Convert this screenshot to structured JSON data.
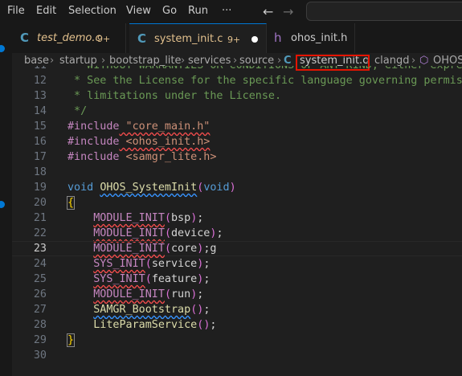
{
  "menubar": {
    "items": [
      "File",
      "Edit",
      "Selection",
      "View",
      "Go",
      "Run",
      "···"
    ],
    "back_arrow": "←",
    "forward_arrow": "→"
  },
  "tabs": [
    {
      "icon": "C",
      "label": "test_demo.c",
      "badge": "9+",
      "italic": true
    },
    {
      "icon": "C",
      "label": "system_init.c",
      "badge": "9+",
      "modified": true
    },
    {
      "icon": "h",
      "label": "ohos_init.h",
      "badge": ""
    }
  ],
  "breadcrumb": {
    "parts": [
      "base",
      "startup",
      "bootstrap_lite",
      "services",
      "source",
      "system_init.c",
      "clangd",
      "OHOS_SystemInit"
    ],
    "file_icon": "C",
    "symbol_icon": "⬡"
  },
  "code": {
    "lines": [
      {
        "n": "11",
        "text": " * WITHOUT WARRANTIES OR CONDITIONS OF ANY KIND, either express or implied."
      },
      {
        "n": "12",
        "text": " * See the License for the specific language governing permissions and"
      },
      {
        "n": "13",
        "text": " * limitations under the License."
      },
      {
        "n": "14",
        "text": " */"
      },
      {
        "n": "15",
        "text": "#include \"core_main.h\""
      },
      {
        "n": "16",
        "text": "#include <ohos_init.h>"
      },
      {
        "n": "17",
        "text": "#include <samgr_lite.h>"
      },
      {
        "n": "18",
        "text": ""
      },
      {
        "n": "19",
        "text": "void OHOS_SystemInit(void)"
      },
      {
        "n": "20",
        "text": "{"
      },
      {
        "n": "21",
        "text": "    MODULE_INIT(bsp);"
      },
      {
        "n": "22",
        "text": "    MODULE_INIT(device);"
      },
      {
        "n": "23",
        "text": "    MODULE_INIT(core);g"
      },
      {
        "n": "24",
        "text": "    SYS_INIT(service);"
      },
      {
        "n": "25",
        "text": "    SYS_INIT(feature);"
      },
      {
        "n": "26",
        "text": "    MODULE_INIT(run);"
      },
      {
        "n": "27",
        "text": "    SAMGR_Bootstrap();"
      },
      {
        "n": "28",
        "text": "    LiteParamService();"
      },
      {
        "n": "29",
        "text": "}"
      },
      {
        "n": "30",
        "text": ""
      }
    ],
    "current_line": "23"
  },
  "colors": {
    "comment": "#6a9955",
    "keyword": "#569cd6",
    "preprocessor": "#c586c0",
    "string": "#ce9178",
    "function": "#dcdcaa",
    "highlight_box": "#e51400",
    "accent": "#0078d4"
  }
}
